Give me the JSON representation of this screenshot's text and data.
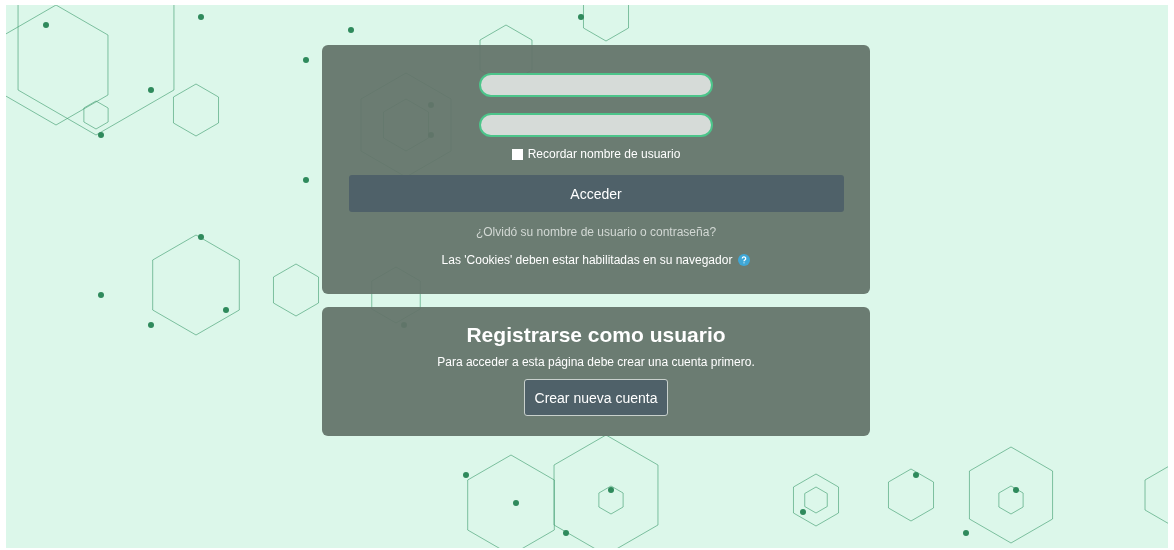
{
  "login": {
    "remember": {
      "label": "Recordar nombre de usuario",
      "checked": false
    },
    "submit": "Acceder",
    "forgot_link": "¿Olvidó su nombre de usuario o contraseña?",
    "cookies_note": "Las 'Cookies' deben estar habilitadas en su navegador"
  },
  "signup": {
    "title": "Registrarse como usuario",
    "text": "Para acceder a esta página debe crear una cuenta primero.",
    "button": "Crear nueva cuenta"
  }
}
